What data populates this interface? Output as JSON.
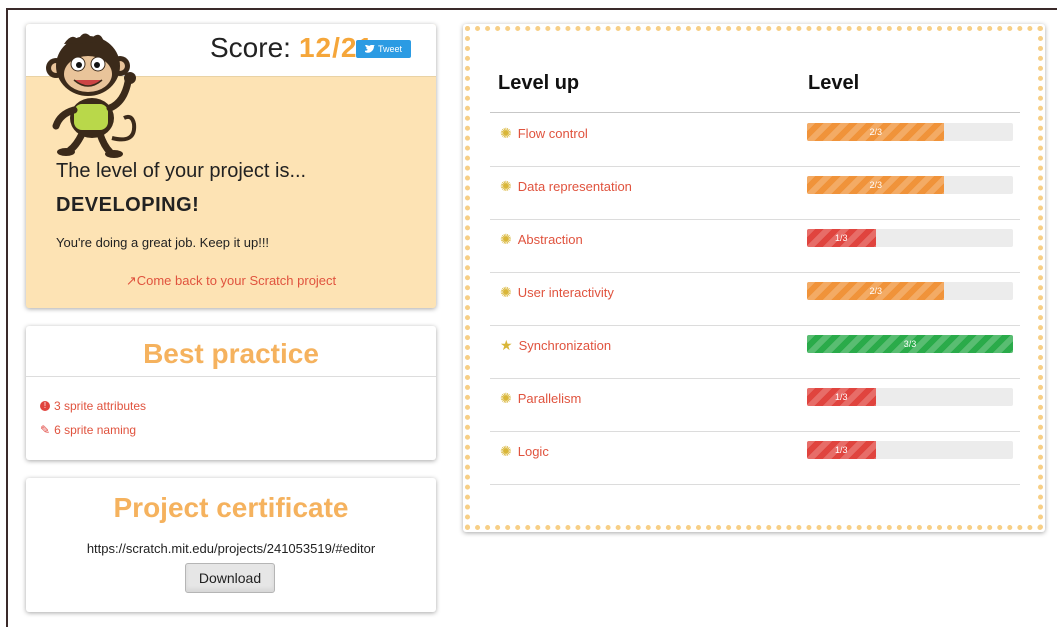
{
  "score": {
    "label": "Score:",
    "value": "12/21",
    "tweet_label": "Tweet"
  },
  "result": {
    "intro": "The level of your project is...",
    "level": "DEVELOPING!",
    "message": "You're doing a great job. Keep it up!!!",
    "back_link": "Come back to your Scratch project"
  },
  "best_practice": {
    "title": "Best practice",
    "items": [
      "3 sprite attributes",
      "6 sprite naming"
    ]
  },
  "certificate": {
    "title": "Project certificate",
    "url": "https://scratch.mit.edu/projects/241053519/#editor",
    "download_label": "Download"
  },
  "levels": {
    "header_left": "Level up",
    "header_right": "Level",
    "rows": [
      {
        "name": "Flow control",
        "score": "2/3",
        "fraction": 0.667,
        "color": "#f0933a"
      },
      {
        "name": "Data representation",
        "score": "2/3",
        "fraction": 0.667,
        "color": "#f0933a"
      },
      {
        "name": "Abstraction",
        "score": "1/3",
        "fraction": 0.333,
        "color": "#e0443e"
      },
      {
        "name": "User interactivity",
        "score": "2/3",
        "fraction": 0.667,
        "color": "#f0933a"
      },
      {
        "name": "Synchronization",
        "score": "3/3",
        "fraction": 1.0,
        "color": "#2aab4a"
      },
      {
        "name": "Parallelism",
        "score": "1/3",
        "fraction": 0.333,
        "color": "#e0443e"
      },
      {
        "name": "Logic",
        "score": "1/3",
        "fraction": 0.333,
        "color": "#e0443e"
      }
    ]
  }
}
